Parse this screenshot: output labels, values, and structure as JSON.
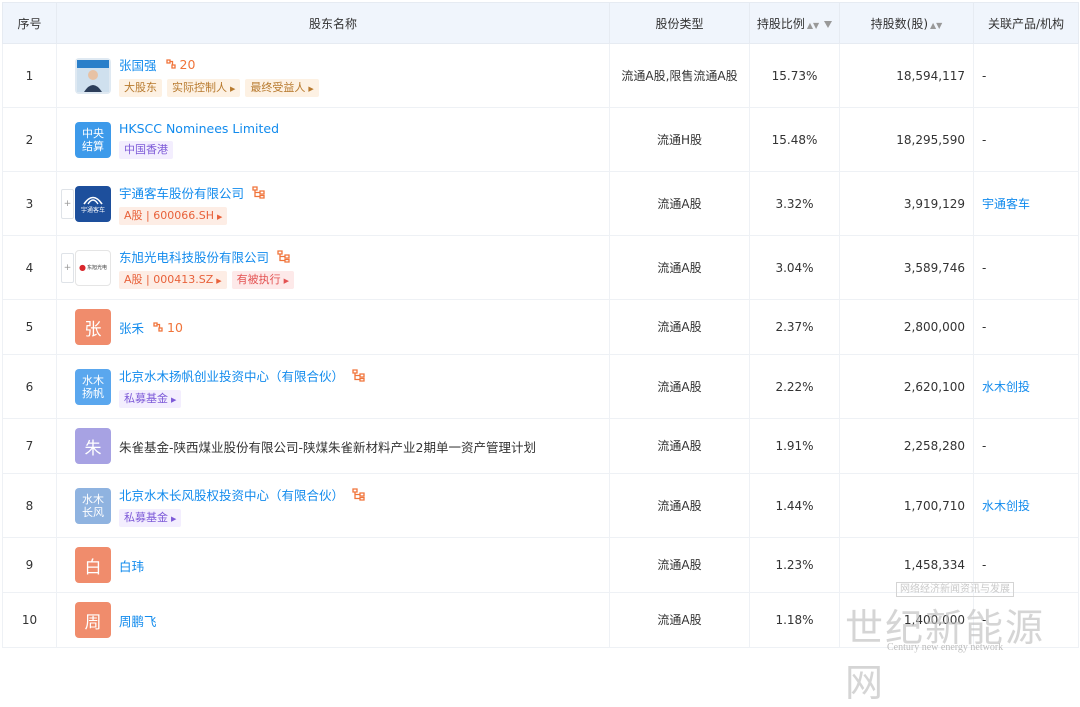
{
  "header": {
    "index": "序号",
    "holder": "股东名称",
    "share_type": "股份类型",
    "ratio": "持股比例",
    "shares": "持股数(股)",
    "related": "关联产品/机构"
  },
  "colors": {
    "link": "#128bed",
    "orange": "#f0743a",
    "header_bg": "#f0f5fc"
  },
  "rows": [
    {
      "index": "1",
      "name": "张国强",
      "avatar_kind": "photo",
      "relations": "20",
      "tags": [
        "大股东",
        "实际控制人",
        "最终受益人"
      ],
      "share_type": "流通A股,限售流通A股",
      "ratio": "15.73%",
      "shares": "18,594,117",
      "related": "-"
    },
    {
      "index": "2",
      "name": "HKSCC Nominees Limited",
      "avatar_text": "中央\n结算",
      "avatar_color": "#3d9aea",
      "tags": [
        "中国香港"
      ],
      "share_type": "流通H股",
      "ratio": "15.48%",
      "shares": "18,295,590",
      "related": "-"
    },
    {
      "index": "3",
      "name": "宇通客车股份有限公司",
      "avatar_text": "宇通客车",
      "avatar_kind": "logo-yutong",
      "tags": [
        "A股 | 600066.SH"
      ],
      "share_type": "流通A股",
      "ratio": "3.32%",
      "shares": "3,919,129",
      "related": "宇通客车"
    },
    {
      "index": "4",
      "name": "东旭光电科技股份有限公司",
      "avatar_text": "东旭光电",
      "avatar_kind": "logo-dongxu",
      "tags": [
        "A股 | 000413.SZ",
        "有被执行"
      ],
      "share_type": "流通A股",
      "ratio": "3.04%",
      "shares": "3,589,746",
      "related": "-"
    },
    {
      "index": "5",
      "name": "张禾",
      "avatar_text": "张",
      "avatar_color": "#f08c6c",
      "relations": "10",
      "share_type": "流通A股",
      "ratio": "2.37%",
      "shares": "2,800,000",
      "related": "-"
    },
    {
      "index": "6",
      "name": "北京水木扬帆创业投资中心（有限合伙）",
      "avatar_text": "水木\n扬帆",
      "avatar_color": "#5aa7ee",
      "tags": [
        "私募基金"
      ],
      "share_type": "流通A股",
      "ratio": "2.22%",
      "shares": "2,620,100",
      "related": "水木创投"
    },
    {
      "index": "7",
      "name": "朱雀基金-陕西煤业股份有限公司-陕煤朱雀新材料产业2期单一资产管理计划",
      "avatar_text": "朱",
      "avatar_color": "#a7a2e3",
      "share_type": "流通A股",
      "ratio": "1.91%",
      "shares": "2,258,280",
      "related": "-"
    },
    {
      "index": "8",
      "name": "北京水木长风股权投资中心（有限合伙）",
      "avatar_text": "水木\n长风",
      "avatar_color": "#8fb3e0",
      "tags": [
        "私募基金"
      ],
      "share_type": "流通A股",
      "ratio": "1.44%",
      "shares": "1,700,710",
      "related": "水木创投"
    },
    {
      "index": "9",
      "name": "白玮",
      "avatar_text": "白",
      "avatar_color": "#f08c6c",
      "share_type": "流通A股",
      "ratio": "1.23%",
      "shares": "1,458,334",
      "related": "-"
    },
    {
      "index": "10",
      "name": "周鹏飞",
      "avatar_text": "周",
      "avatar_color": "#f08c6c",
      "share_type": "流通A股",
      "ratio": "1.18%",
      "shares": "1,400,000",
      "related": "-"
    }
  ],
  "watermark": {
    "tagline": "网络经济新闻资讯与发展",
    "brand": "世纪新能源网",
    "english": "Century new energy network"
  }
}
